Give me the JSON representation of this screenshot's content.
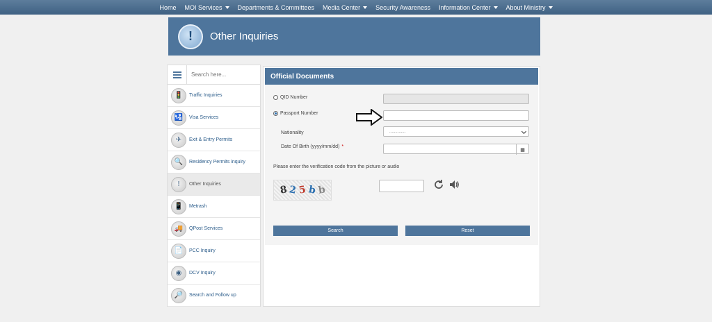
{
  "nav": {
    "items": [
      {
        "label": "Home",
        "dropdown": false
      },
      {
        "label": "MOI Services",
        "dropdown": true
      },
      {
        "label": "Departments & Committees",
        "dropdown": false
      },
      {
        "label": "Media Center",
        "dropdown": true
      },
      {
        "label": "Security Awareness",
        "dropdown": false
      },
      {
        "label": "Information Center",
        "dropdown": true
      },
      {
        "label": "About Ministry",
        "dropdown": true
      }
    ]
  },
  "banner": {
    "title": "Other Inquiries",
    "icon_glyph": "!"
  },
  "sidebar": {
    "search_placeholder": "Search here...",
    "items": [
      {
        "label": "Traffic Inquiries",
        "icon": "traffic-light-icon",
        "glyph": "🚦"
      },
      {
        "label": "Visa Services",
        "icon": "visa-icon",
        "glyph": "🛂"
      },
      {
        "label": "Exit & Entry Permits",
        "icon": "airplane-icon",
        "glyph": "✈"
      },
      {
        "label": "Residency Permits inquiry",
        "icon": "residency-icon",
        "glyph": "🔍"
      },
      {
        "label": "Other Inquiries",
        "icon": "info-icon",
        "glyph": "!",
        "active": true
      },
      {
        "label": "Metrash",
        "icon": "phone-icon",
        "glyph": "📱"
      },
      {
        "label": "QPost Services",
        "icon": "post-icon",
        "glyph": "🚚"
      },
      {
        "label": "PCC Inquiry",
        "icon": "document-icon",
        "glyph": "📄"
      },
      {
        "label": "DCV Inquiry",
        "icon": "fingerprint-icon",
        "glyph": "◉"
      },
      {
        "label": "Search and Follow up",
        "icon": "search-follow-icon",
        "glyph": "🔎"
      }
    ]
  },
  "form": {
    "title": "Official Documents",
    "qid_label": "QID Number",
    "passport_label": "Passport Number",
    "nationality_label": "Nationality",
    "nationality_value": "..............",
    "dob_label": "Date Of Birth (yyyy/mm/dd)",
    "required_mark": "*",
    "captcha_prompt": "Please enter the verification code from the picture or audio",
    "captcha_chars": [
      "8",
      "2",
      "5",
      "b",
      "b"
    ],
    "search_label": "Search",
    "reset_label": "Reset",
    "selected_option": "passport"
  },
  "colors": {
    "primary": "#4e759c",
    "nav": "#3f6183"
  }
}
